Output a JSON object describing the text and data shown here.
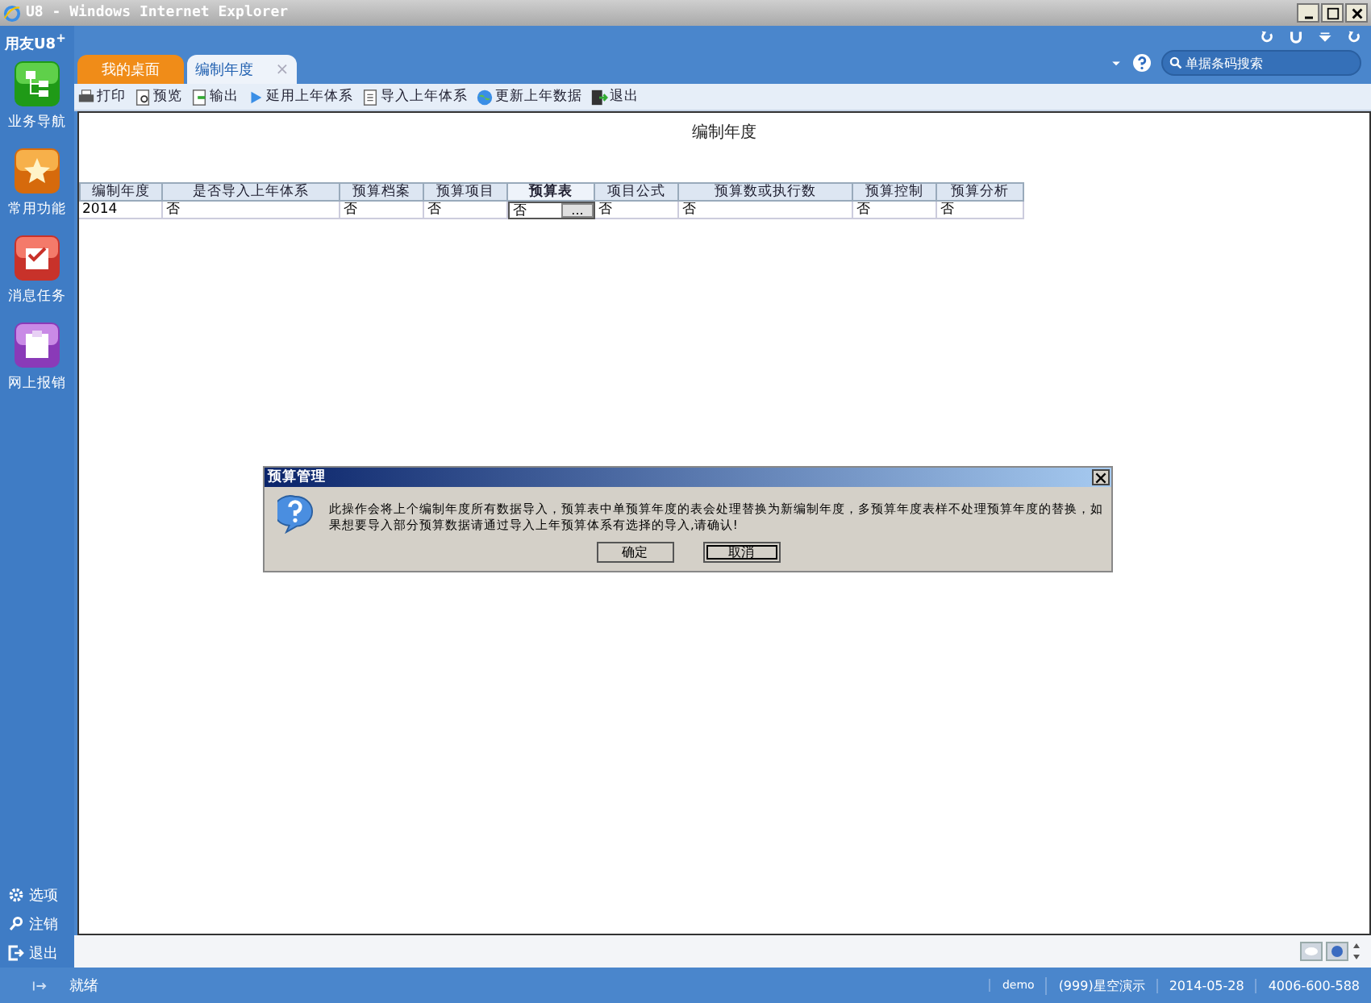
{
  "window": {
    "title": "U8 - Windows Internet Explorer"
  },
  "app": {
    "logo": "用友U8$^{+}$",
    "search": {
      "placeholder": "单据条码搜索"
    }
  },
  "sidebar": {
    "items": [
      {
        "label": "业务导航",
        "kind": "nav"
      },
      {
        "label": "常用功能",
        "kind": "star"
      },
      {
        "label": "消息任务",
        "kind": "task"
      },
      {
        "label": "网上报销",
        "kind": "expense"
      }
    ],
    "bottom_items": [
      {
        "label": "选项",
        "kind": "gear"
      },
      {
        "label": "注销",
        "kind": "key"
      },
      {
        "label": "退出",
        "kind": "exit"
      }
    ]
  },
  "tabs": [
    {
      "label": "我的桌面",
      "selected": false,
      "closable": false
    },
    {
      "label": "编制年度",
      "selected": true,
      "closable": true,
      "close_glyph": "×"
    }
  ],
  "toolbar": [
    {
      "label": "打印",
      "kind": "print"
    },
    {
      "label": "预览",
      "kind": "preview"
    },
    {
      "label": "输出",
      "kind": "output"
    },
    {
      "label": "延用上年体系",
      "kind": "play"
    },
    {
      "label": "导入上年体系",
      "kind": "import"
    },
    {
      "label": "更新上年数据",
      "kind": "update"
    },
    {
      "label": "退出",
      "kind": "exit"
    }
  ],
  "page_title": "编制年度",
  "table": {
    "columns": [
      {
        "label": "编制年度",
        "selected": false
      },
      {
        "label": "是否导入上年体系",
        "selected": false
      },
      {
        "label": "预算档案",
        "selected": false
      },
      {
        "label": "预算项目",
        "selected": false
      },
      {
        "label": "预算表",
        "selected": true
      },
      {
        "label": "项目公式",
        "selected": false
      },
      {
        "label": "预算数或执行数",
        "selected": false
      },
      {
        "label": "预算控制",
        "selected": false
      },
      {
        "label": "预算分析",
        "selected": false
      }
    ],
    "rows": [
      {
        "cells": [
          "2014",
          "否",
          "否",
          "否",
          "否",
          "否",
          "否",
          "否",
          "否"
        ]
      }
    ],
    "ellipsis_button": "..."
  },
  "dialog": {
    "title": "预算管理",
    "message": "此操作会将上个编制年度所有数据导入，预算表中单预算年度的表会处理替换为新编制年度，多预算年度表样不处理预算年度的替换，如果想要导入部分预算数据请通过导入上年预算体系有选择的导入,请确认!",
    "buttons": [
      "确定",
      "取消"
    ]
  },
  "status_bar": {
    "status": "就绪",
    "user": "demo",
    "account": "(999)星空演示",
    "date": "2014-05-28",
    "phone": "4006-600-588"
  }
}
